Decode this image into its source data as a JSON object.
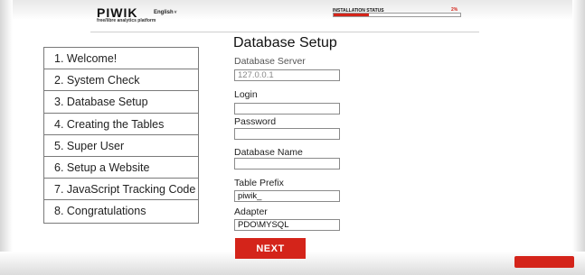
{
  "header": {
    "logo": "PIWIK",
    "tagline": "free/libre analytics platform",
    "language": "English",
    "language_caret": "˅",
    "installation_status_label": "INSTALLATION STATUS",
    "installation_status_percent": "2%",
    "progress_fraction": 0.28
  },
  "steps": [
    {
      "label": "1. Welcome!"
    },
    {
      "label": "2. System Check"
    },
    {
      "label": "3. Database Setup"
    },
    {
      "label": "4. Creating the Tables"
    },
    {
      "label": "5. Super User"
    },
    {
      "label": "6. Setup a Website"
    },
    {
      "label": "7. JavaScript Tracking Code"
    },
    {
      "label": "8. Congratulations"
    }
  ],
  "form": {
    "title": "Database Setup",
    "db_server": {
      "label": "Database Server",
      "value": "127.0.0.1"
    },
    "login": {
      "label": "Login",
      "value": ""
    },
    "password": {
      "label": "Password",
      "value": ""
    },
    "db_name": {
      "label": "Database Name",
      "value": ""
    },
    "table_prefix": {
      "label": "Table Prefix",
      "value": "piwik_"
    },
    "adapter": {
      "label": "Adapter",
      "value": "PDO\\MYSQL"
    },
    "next_label": "NEXT"
  },
  "colors": {
    "accent": "#d4241a"
  }
}
